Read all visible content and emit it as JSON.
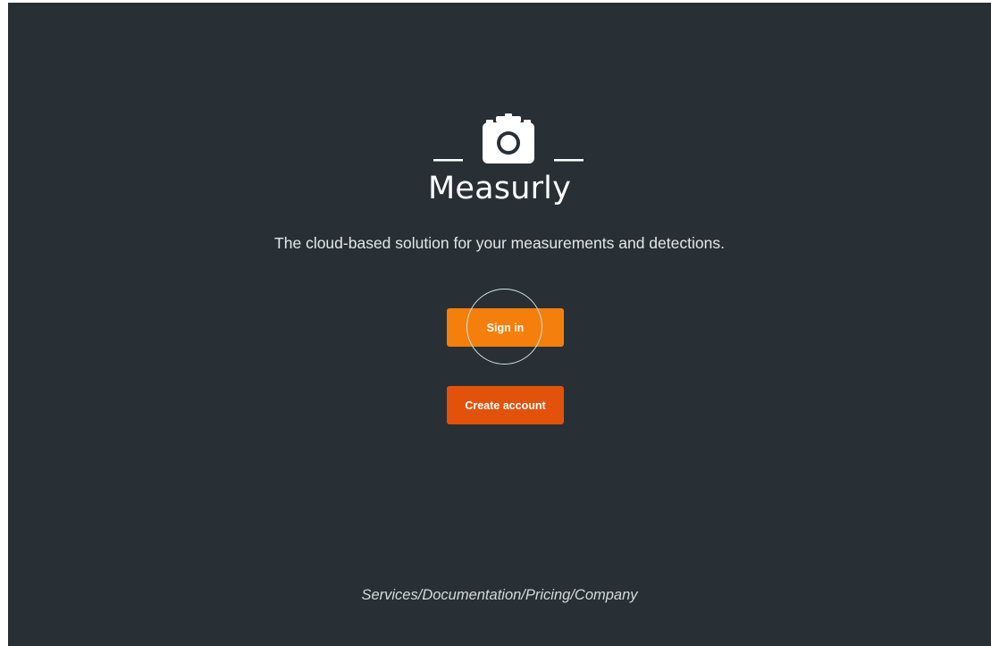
{
  "app": {
    "brand_name": "Measurly",
    "logo_icon": "camera-icon",
    "tagline": "The cloud-based solution for your measurements and detections."
  },
  "actions": {
    "sign_in_label": "Sign in",
    "create_account_label": "Create account"
  },
  "footer": {
    "links": [
      "Services",
      "Documentation",
      "Pricing",
      "Company"
    ],
    "separator": "/"
  },
  "colors": {
    "background": "#283035",
    "sign_in_button": "#f57f0c",
    "create_account_button": "#e2520a",
    "text": "#ffffff"
  }
}
